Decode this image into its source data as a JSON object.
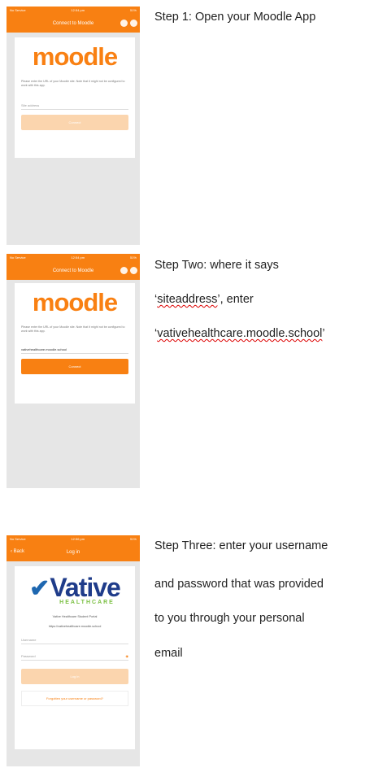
{
  "steps": {
    "step1": "Step 1: Open your Moodle App",
    "step2_line1": "Step Two: where it says",
    "step2_q_open": "‘",
    "step2_siteaddress": "siteaddress",
    "step2_rest": "’, enter",
    "step2_q_open2": "‘",
    "step2_url": "vativehealthcare.moodle.school",
    "step2_q_close": "’",
    "step3_line1": "Step Three: enter your username",
    "step3_line2": "and password that was provided",
    "step3_line3": "to you through your personal",
    "step3_line4": "email"
  },
  "screen1": {
    "status_left": "No Service",
    "status_time": "12:54 pm",
    "status_right": "51%",
    "nav_title": "Connect to Moodle",
    "logo_m": "m",
    "logo_rest": "oodle",
    "logo_cap": "‾",
    "description": "Please enter the URL of your Moodle site. Note that it might not be configured to work with this app.",
    "site_placeholder": "Site address",
    "connect_label": "Connect"
  },
  "screen2": {
    "status_left": "No Service",
    "status_time": "12:54 pm",
    "status_right": "51%",
    "nav_title": "Connect to Moodle",
    "logo_m": "m",
    "logo_rest": "oodle",
    "description": "Please enter the URL of your Moodle site. Note that it might not be configured to work with this app.",
    "site_value": "vativehealthcare.moodle.school",
    "connect_label": "Connect"
  },
  "screen3": {
    "status_left": "No Service",
    "status_time": "12:56 pm",
    "status_right": "51%",
    "back_label": "Back",
    "nav_title": "Log in",
    "logo_word": "Vative",
    "logo_sub": "HEALTHCARE",
    "portal_name": "Vative Healthcare Student Portal",
    "portal_url": "https://vativehealthcare.moodle.school",
    "username_placeholder": "Username",
    "password_placeholder": "Password",
    "login_label": "Log in",
    "forgot_label": "Forgotten your username or password?"
  },
  "colors": {
    "accent": "#f88012",
    "screen_bg": "#e6e6e6"
  },
  "icons": {
    "eye": "eye-icon",
    "check": "checkmark-logo-icon"
  }
}
